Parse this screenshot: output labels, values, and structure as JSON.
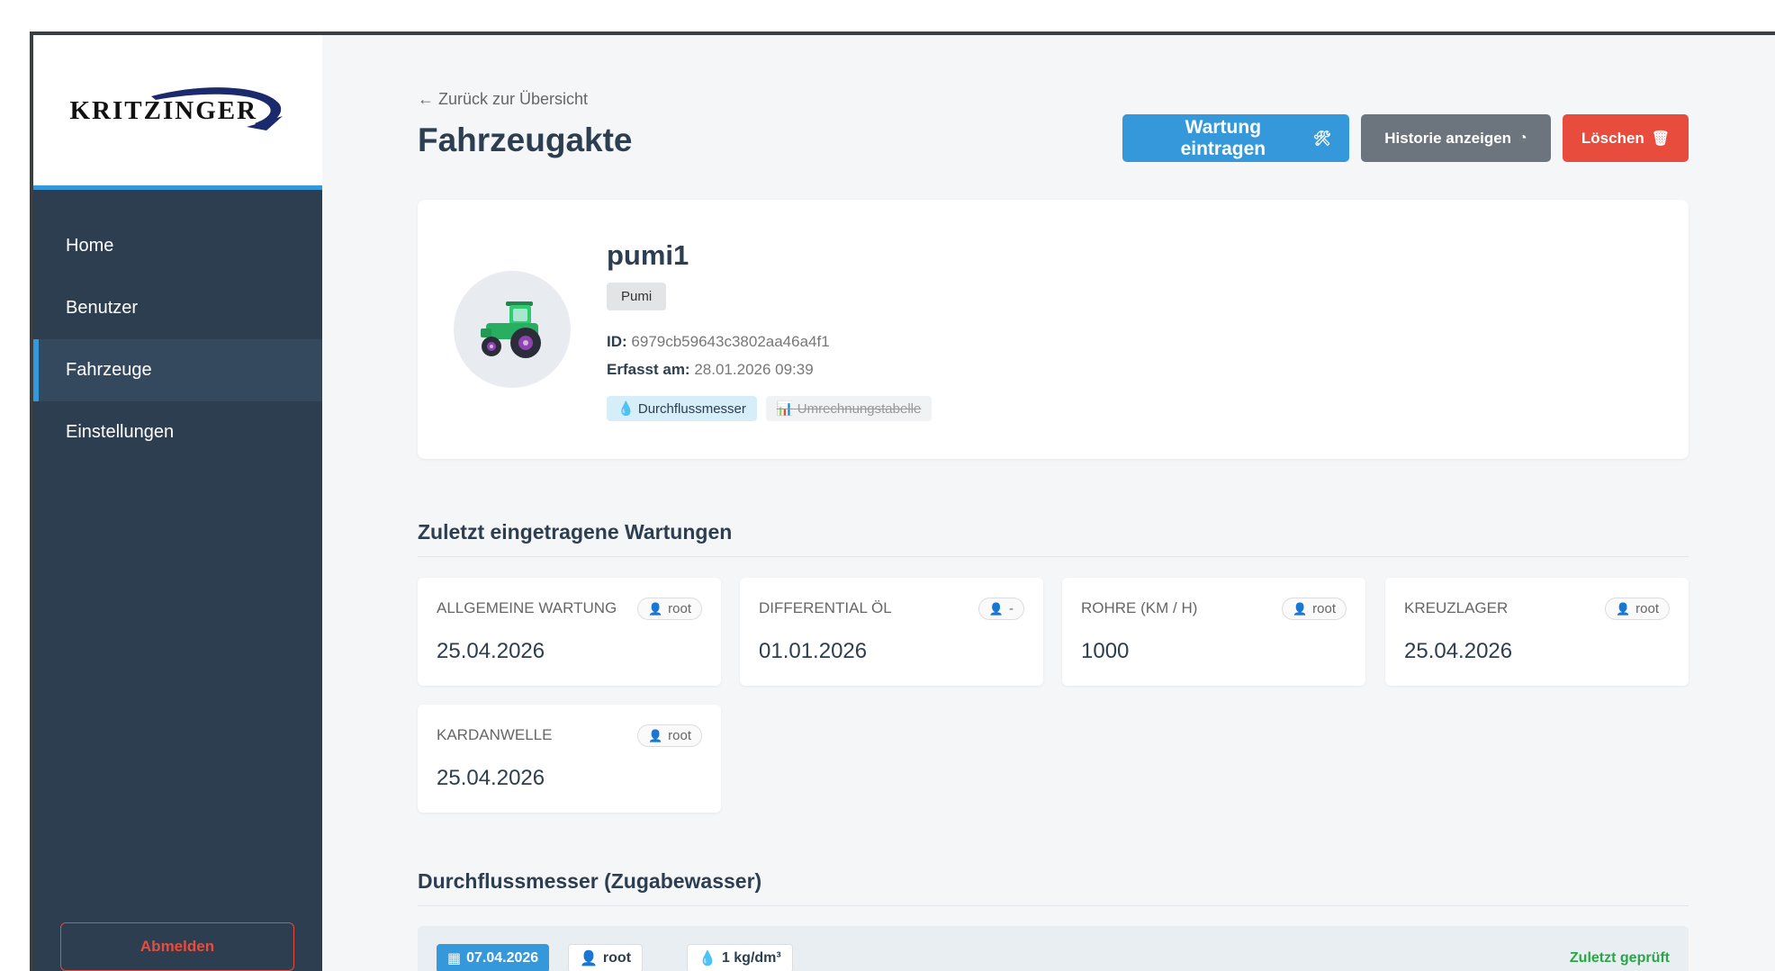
{
  "brand": {
    "logo_text": "KRITZINGER",
    "accent": "#3498db",
    "sidebar_bg": "#2c3e50"
  },
  "sidebar": {
    "items": [
      {
        "label": "Home"
      },
      {
        "label": "Benutzer"
      },
      {
        "label": "Fahrzeuge",
        "active": true
      },
      {
        "label": "Einstellungen"
      }
    ],
    "logout_label": "Abmelden"
  },
  "header": {
    "back_label": "← Zurück zur Übersicht",
    "title": "Fahrzeugakte",
    "actions": {
      "maintenance_label": "Wartung eintragen",
      "maintenance_icon": "🛠",
      "history_label": "Historie anzeigen",
      "history_icon": "◔",
      "delete_label": "Löschen",
      "delete_icon": "🗑"
    }
  },
  "vehicle": {
    "name": "pumi1",
    "type": "Pumi",
    "id_label": "ID:",
    "id_value": "6979cb59643c3802aa46a4f1",
    "created_label": "Erfasst am:",
    "created_value": "28.01.2026 09:39",
    "tags": [
      {
        "icon": "💧",
        "label": "Durchflussmesser",
        "active": true
      },
      {
        "icon": "📊",
        "label": "Umrechnungstabelle",
        "active": false
      }
    ]
  },
  "maintenance": {
    "title": "Zuletzt eingetragene Wartungen",
    "items": [
      {
        "label": "ALLGEMEINE WARTUNG",
        "user": "root",
        "value": "25.04.2026"
      },
      {
        "label": "DIFFERENTIAL ÖL",
        "user": "-",
        "value": "01.01.2026"
      },
      {
        "label": "ROHRE (KM / H)",
        "user": "root",
        "value": "1000"
      },
      {
        "label": "KREUZLAGER",
        "user": "root",
        "value": "25.04.2026"
      },
      {
        "label": "KARDANWELLE",
        "user": "root",
        "value": "25.04.2026"
      }
    ]
  },
  "flowmeter": {
    "title": "Durchflussmesser (Zugabewasser)",
    "date": "07.04.2026",
    "user": "root",
    "value": "1 kg/dm³",
    "status": "Zuletzt geprüft"
  }
}
